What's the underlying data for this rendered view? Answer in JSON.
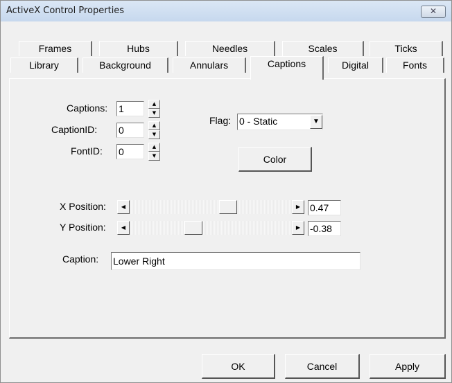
{
  "window": {
    "title": "ActiveX Control Properties",
    "close_glyph": "✕"
  },
  "tabs": {
    "row1": [
      "Frames",
      "Hubs",
      "Needles",
      "Scales",
      "Ticks"
    ],
    "row2": [
      "Library",
      "Background",
      "Annulars",
      "Captions",
      "Digital",
      "Fonts"
    ],
    "active": "Captions"
  },
  "captions": {
    "captions_label": "Captions:",
    "captions_value": "1",
    "captionid_label": "CaptionID:",
    "captionid_value": "0",
    "fontid_label": "FontID:",
    "fontid_value": "0",
    "flag_label": "Flag:",
    "flag_value": "0 - Static",
    "color_button": "Color",
    "xpos_label": "X Position:",
    "xpos_value": "0.47",
    "ypos_label": "Y Position:",
    "ypos_value": "-0.38",
    "caption_label": "Caption:",
    "caption_value": "Lower Right"
  },
  "footer": {
    "ok": "OK",
    "cancel": "Cancel",
    "apply": "Apply"
  },
  "icons": {
    "spin_up": "▲",
    "spin_down": "▼",
    "combo_arrow": "▼",
    "scroll_left": "◀",
    "scroll_right": "▶"
  },
  "scroll_levels": {
    "x_position_fraction": 0.62,
    "y_position_fraction": 0.38
  }
}
